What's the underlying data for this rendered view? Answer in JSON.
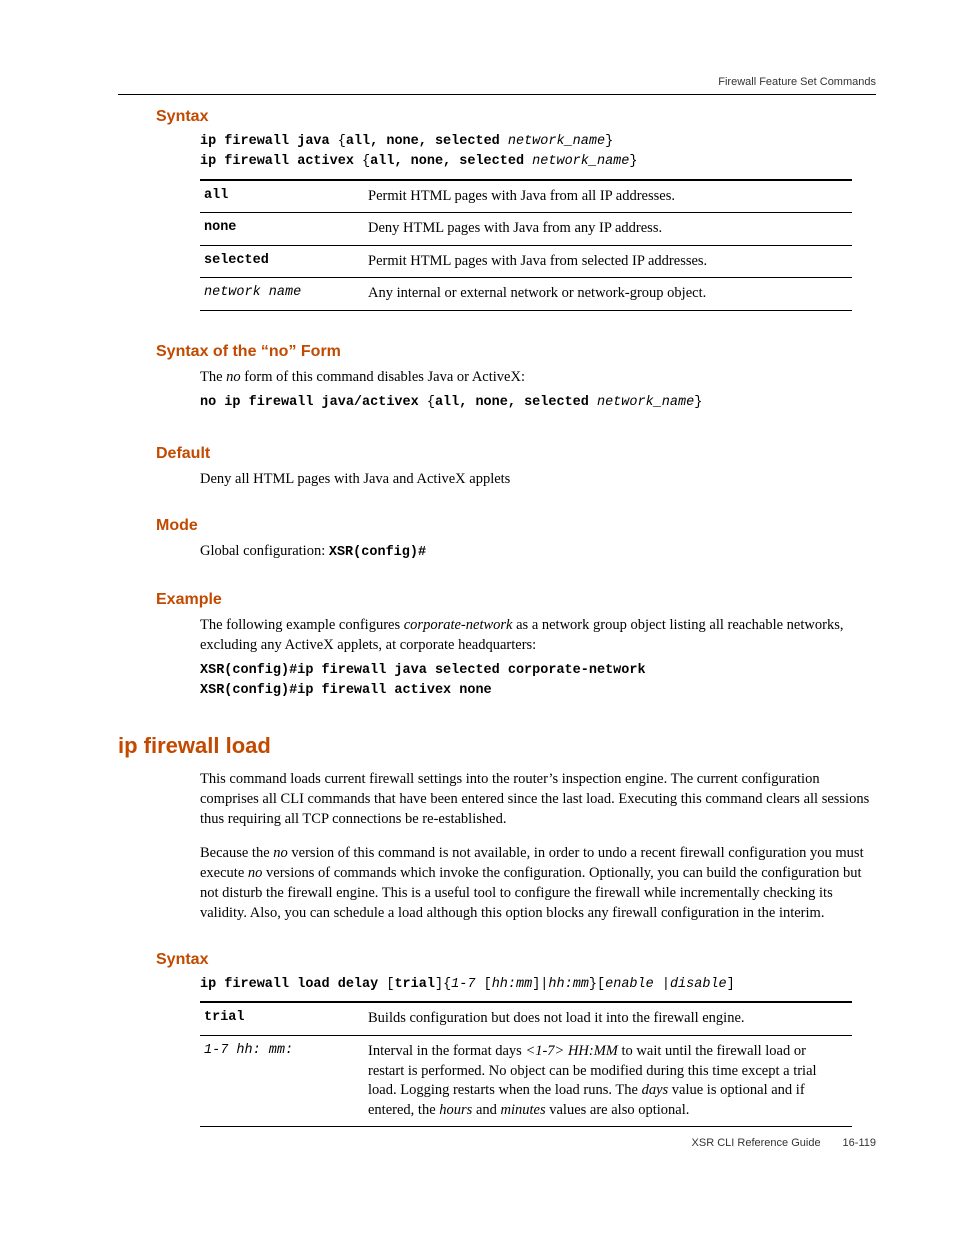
{
  "header": {
    "right_text": "Firewall Feature Set Commands"
  },
  "sections": {
    "syntax1": {
      "heading": "Syntax",
      "cmd_line1_a": "ip firewall java ",
      "cmd_line1_b": "{",
      "cmd_line1_c": "all, none, selected ",
      "cmd_line1_d": "network_name",
      "cmd_line1_e": "}",
      "cmd_line2_a": "ip firewall activex ",
      "cmd_line2_b": "{",
      "cmd_line2_c": "all, none, selected ",
      "cmd_line2_d": "network_name",
      "cmd_line2_e": "}",
      "table": [
        {
          "key": "all",
          "key_bold": true,
          "desc": "Permit HTML pages with Java from all IP addresses."
        },
        {
          "key": "none",
          "key_bold": true,
          "desc": "Deny HTML pages with Java from any IP address."
        },
        {
          "key": "selected",
          "key_bold": true,
          "desc": "Permit HTML pages with Java from selected IP addresses."
        },
        {
          "key": "network name",
          "key_bold": false,
          "key_italic": true,
          "desc": "Any internal or external network or network-group object."
        }
      ]
    },
    "no_form": {
      "heading": "Syntax of the “no” Form",
      "intro_a": "The ",
      "intro_b": "no",
      "intro_c": " form of this command disables Java or ActiveX:",
      "cmd_a": "no ip firewall java/activex ",
      "cmd_b": "{",
      "cmd_c": "all, none, selected ",
      "cmd_d": "network_name",
      "cmd_e": "}"
    },
    "default": {
      "heading": "Default",
      "text": "Deny all HTML pages with Java and ActiveX applets"
    },
    "mode": {
      "heading": "Mode",
      "text_a": "Global configuration: ",
      "text_b": "XSR(config)#"
    },
    "example": {
      "heading": "Example",
      "intro_a": "The following example configures ",
      "intro_b": "corporate-network",
      "intro_c": " as a network group object listing all reachable networks, excluding any ActiveX applets, at corporate headquarters:",
      "cmd1": "XSR(config)#ip firewall java selected corporate-network",
      "cmd2": "XSR(config)#ip firewall activex none"
    },
    "command2": {
      "heading": "ip firewall load",
      "para1": "This command loads current firewall settings into the router’s inspection engine. The current configuration comprises all CLI commands that have been entered since the last load. Executing this command clears all sessions thus requiring all TCP connections be re-established.",
      "para2_a": "Because the ",
      "para2_b": "no",
      "para2_c": " version of this command is not available, in order to undo a recent firewall configuration you must execute ",
      "para2_d": "no",
      "para2_e": " versions of commands which invoke the configuration. Optionally, you can build the configuration but not disturb the firewall engine. This is a useful tool to configure the firewall while incrementally checking its validity. Also, you can schedule a load although this option blocks any firewall configuration in the interim."
    },
    "syntax2": {
      "heading": "Syntax",
      "cmd_a": "ip firewall load",
      "cmd_b": " delay ",
      "cmd_c": "[",
      "cmd_d": "trial",
      "cmd_e": "]{",
      "cmd_f": "1-7 ",
      "cmd_g": "[",
      "cmd_h": "hh:mm",
      "cmd_i": "]|",
      "cmd_j": "hh:mm",
      "cmd_k": "}[",
      "cmd_l": "enable ",
      "cmd_m": "|",
      "cmd_n": "disable",
      "cmd_o": "]",
      "table": [
        {
          "key": "trial",
          "key_bold": true,
          "desc_pre": "Builds configuration but does not load it into the firewall engine."
        },
        {
          "key": "1-7 hh: mm:",
          "key_bold": false,
          "key_italic": true,
          "desc_a": "Interval in the format days ",
          "desc_b": "<1-7> HH:MM",
          "desc_c": " to wait until the firewall load or restart is performed. No object can be modified during this time except a trial load. Logging restarts when the load runs. The ",
          "desc_d": "days",
          "desc_e": " value is optional and if entered, the ",
          "desc_f": "hours",
          "desc_g": " and ",
          "desc_h": "minutes",
          "desc_i": " values are also optional."
        }
      ]
    }
  },
  "footer": {
    "text": "XSR CLI Reference Guide  16-119"
  }
}
